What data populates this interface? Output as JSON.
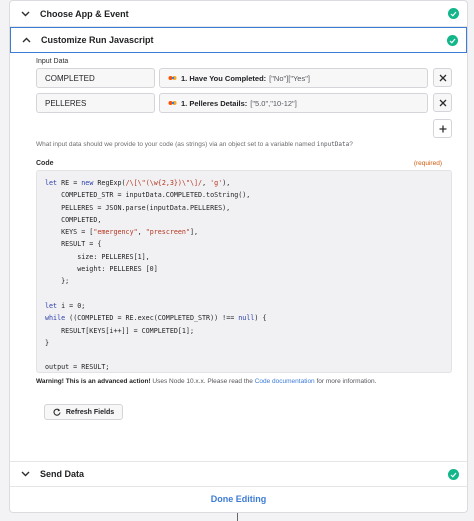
{
  "sections": {
    "choose_app": {
      "title": "Choose App & Event"
    },
    "customize": {
      "title": "Customize Run Javascript"
    },
    "send_data": {
      "title": "Send Data"
    }
  },
  "input_data": {
    "label": "Input Data",
    "rows": [
      {
        "key": "COMPLETED",
        "field_name": "1. Have You Completed:",
        "field_value": "[\"No\"][\"Yes\"]"
      },
      {
        "key": "PELLERES",
        "field_name": "1. Pelleres Details:",
        "field_value": "[\"5.0\",\"10-12\"]"
      }
    ],
    "hint_prefix": "What input data should we provide to your code (as strings) via an object set to a variable named",
    "hint_var": "inputData",
    "hint_suffix": "?"
  },
  "code": {
    "label": "Code",
    "required": "(required)"
  },
  "warning": {
    "bold": "Warning! This is an advanced action!",
    "text": " Uses Node 10.x.x. Please read the ",
    "link": "Code documentation",
    "tail": " for more information."
  },
  "buttons": {
    "refresh": "Refresh Fields",
    "done": "Done Editing"
  },
  "icons": {
    "chevron": "chevron-down-icon",
    "check": "check-circle-icon",
    "close": "close-icon",
    "plus": "plus-icon",
    "refresh": "refresh-icon",
    "zap": "zapier-step-icon"
  },
  "colors": {
    "accent": "#3c7bd6",
    "success": "#13b58a",
    "required": "#d15b0b"
  }
}
